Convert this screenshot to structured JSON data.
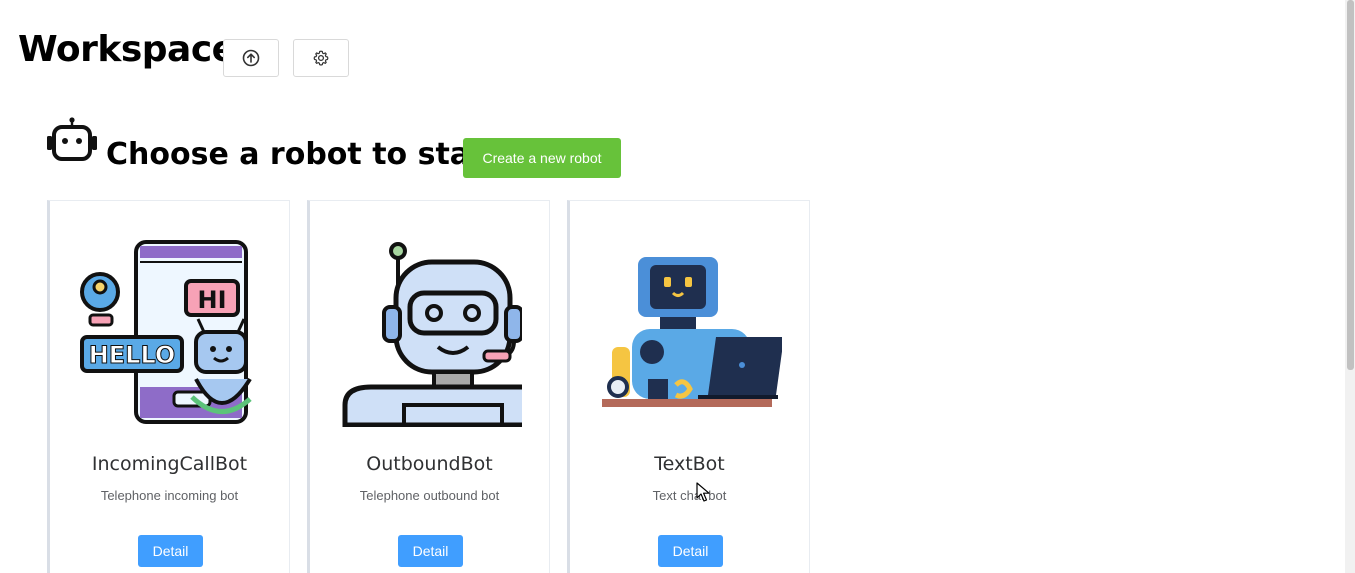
{
  "workspace": {
    "title": "Workspace",
    "upload_icon": "upload-circle-icon",
    "settings_icon": "gear-icon"
  },
  "section": {
    "icon": "robot-head-icon",
    "title": "Choose a robot to start",
    "create_label": "Create a new robot"
  },
  "robots": [
    {
      "name": "IncomingCallBot",
      "description": "Telephone incoming bot",
      "detail_label": "Detail"
    },
    {
      "name": "OutboundBot",
      "description": "Telephone outbound bot",
      "detail_label": "Detail"
    },
    {
      "name": "TextBot",
      "description": "Text chat bot",
      "detail_label": "Detail"
    }
  ],
  "colors": {
    "create_button": "#67c23a",
    "detail_button": "#409eff"
  }
}
